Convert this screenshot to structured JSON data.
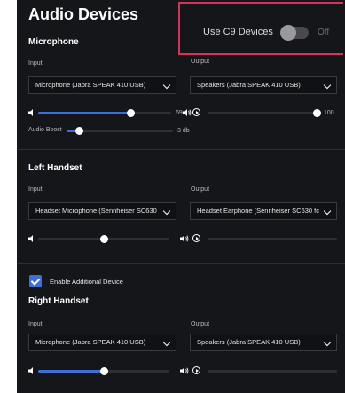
{
  "page": {
    "title": "Audio Devices"
  },
  "c9": {
    "label": "Use C9 Devices",
    "state": "Off",
    "enabled": false
  },
  "microphone": {
    "title": "Microphone",
    "input_label": "Input",
    "output_label": "Output",
    "input_value": "Microphone (Jabra SPEAK 410 USB)",
    "output_value": "Speakers (Jabra SPEAK 410 USB)",
    "input_volume": {
      "value": 69,
      "display": "69"
    },
    "output_volume": {
      "value": 100,
      "display": "100"
    },
    "boost": {
      "label": "Audio Boost",
      "value": 3,
      "display": "3 db",
      "fraction": 0.12
    }
  },
  "left_handset": {
    "title": "Left Handset",
    "input_label": "Input",
    "output_label": "Output",
    "input_value": "Headset Microphone (Sennheiser SC630",
    "output_value": "Headset Earphone (Sennheiser SC630 fc",
    "input_volume": {
      "value": 50
    },
    "output_volume": {
      "value": 0
    }
  },
  "additional": {
    "label": "Enable Additional Device",
    "checked": true
  },
  "right_handset": {
    "title": "Right Handset",
    "input_label": "Input",
    "output_label": "Output",
    "input_value": "Microphone (Jabra SPEAK 410 USB)",
    "output_value": "Speakers (Jabra SPEAK 410 USB)",
    "input_volume": {
      "value": 50
    },
    "output_volume": {
      "value": 0
    }
  },
  "colors": {
    "accent": "#3b6fd9",
    "highlight_border": "#d8325a",
    "panel_bg": "#15161a"
  }
}
